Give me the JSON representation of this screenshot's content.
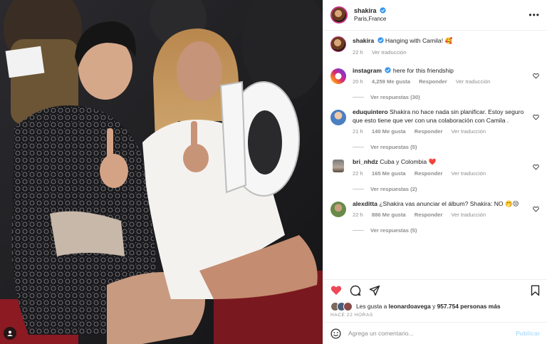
{
  "post": {
    "author": "shakira",
    "location": "Paris,France"
  },
  "caption": {
    "author": "shakira",
    "text": "Hanging with Camila! 🥰",
    "time": "22 h",
    "translate": "Ver traducción"
  },
  "comments": [
    {
      "user": "instagram",
      "verified": true,
      "text": "here for this friendship",
      "time": "20 h",
      "likes": "4,259 Me gusta",
      "reply": "Responder",
      "translate": "Ver traducción",
      "replies": "Ver respuestas (30)"
    },
    {
      "user": "eduquintero",
      "verified": false,
      "text": "Shakira no hace nada sin planificar. Estoy seguro que esto tiene que ver con una colaboración con Camila .",
      "time": "21 h",
      "likes": "140 Me gusta",
      "reply": "Responder",
      "translate": "Ver traducción",
      "replies": "Ver respuestas (5)"
    },
    {
      "user": "bri_nhdz",
      "verified": false,
      "text": "Cuba y Colombia ❤️",
      "time": "22 h",
      "likes": "165 Me gusta",
      "reply": "Responder",
      "translate": "Ver traducción",
      "replies": "Ver respuestas (2)"
    },
    {
      "user": "alexditta",
      "verified": false,
      "text": "¿Shakira vas anunciar el álbum? Shakira: NO 🤭😒",
      "time": "22 h",
      "likes": "886 Me gusta",
      "reply": "Responder",
      "translate": "Ver traducción",
      "replies": "Ver respuestas (5)"
    }
  ],
  "likes": {
    "prefix": "Les gusta a",
    "user": "leonardoavega",
    "middle": "y",
    "count": "957.754 personas más"
  },
  "ago": "HACE 22 HORAS",
  "add_comment": {
    "placeholder": "Agrega un comentario...",
    "publish": "Publicar"
  },
  "colors": {
    "heart": "#ed4956",
    "verified": "#3897f0",
    "link_disabled": "#b2dffc"
  }
}
